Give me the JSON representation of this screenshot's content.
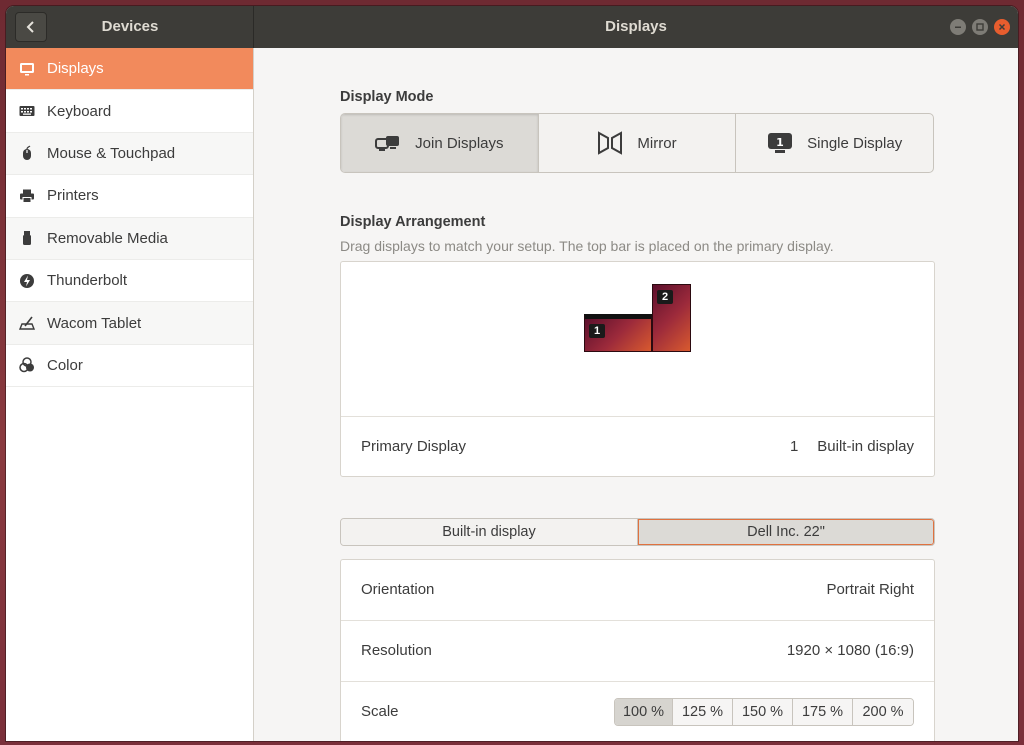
{
  "window": {
    "sidebar_title": "Devices",
    "main_title": "Displays"
  },
  "sidebar": {
    "items": [
      {
        "label": "Displays",
        "icon": "display-icon",
        "active": true
      },
      {
        "label": "Keyboard",
        "icon": "keyboard-icon"
      },
      {
        "label": "Mouse & Touchpad",
        "icon": "mouse-icon"
      },
      {
        "label": "Printers",
        "icon": "printer-icon"
      },
      {
        "label": "Removable Media",
        "icon": "usb-drive-icon"
      },
      {
        "label": "Thunderbolt",
        "icon": "thunderbolt-icon"
      },
      {
        "label": "Wacom Tablet",
        "icon": "tablet-icon"
      },
      {
        "label": "Color",
        "icon": "color-icon"
      }
    ]
  },
  "display_mode": {
    "heading": "Display Mode",
    "options": [
      {
        "label": "Join Displays",
        "icon": "join-displays-icon",
        "selected": true
      },
      {
        "label": "Mirror",
        "icon": "mirror-icon"
      },
      {
        "label": "Single Display",
        "icon": "single-display-icon"
      }
    ]
  },
  "arrangement": {
    "heading": "Display Arrangement",
    "description": "Drag displays to match your setup. The top bar is placed on the primary display.",
    "monitors": [
      {
        "number": "1"
      },
      {
        "number": "2"
      }
    ],
    "primary_label": "Primary Display",
    "primary_number": "1",
    "primary_value": "Built-in display"
  },
  "display_tabs": [
    {
      "label": "Built-in display"
    },
    {
      "label": "Dell Inc. 22\"",
      "selected": true
    }
  ],
  "settings": {
    "orientation_label": "Orientation",
    "orientation_value": "Portrait Right",
    "resolution_label": "Resolution",
    "resolution_value": "1920 × 1080 (16:9)",
    "scale_label": "Scale",
    "scale_options": [
      "100 %",
      "125 %",
      "150 %",
      "175 %",
      "200 %"
    ],
    "scale_selected": "100 %"
  },
  "colors": {
    "accent": "#f28a5c",
    "titlebar": "#3d3c38",
    "close_button": "#e75d2e"
  }
}
